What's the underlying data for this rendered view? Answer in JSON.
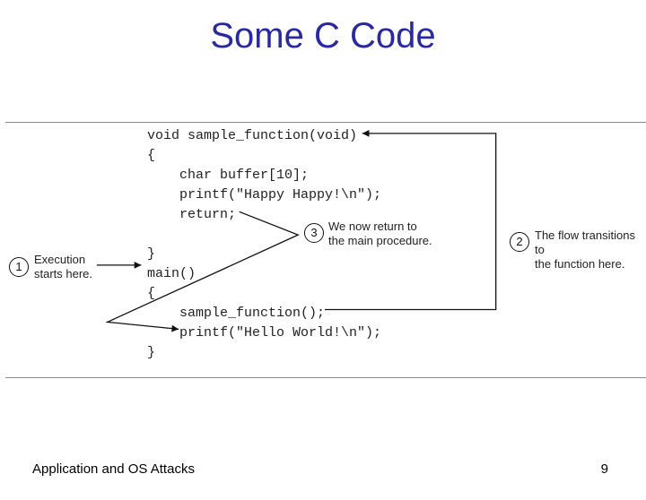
{
  "title": "Some C Code",
  "footer": {
    "left": "Application and OS Attacks",
    "page": "9"
  },
  "code": {
    "l1": "void sample_function(void)",
    "l2": "{",
    "l3": "    char buffer[10];",
    "l4": "    printf(\"Happy Happy!\\n\");",
    "l5": "    return;",
    "l6": "}",
    "l7": "main()",
    "l8": "{",
    "l9": "    sample_function();",
    "l10": "    printf(\"Hello World!\\n\");",
    "l11": "}"
  },
  "markers": {
    "m1": "1",
    "m2": "2",
    "m3": "3"
  },
  "captions": {
    "c1a": "Execution",
    "c1b": "starts here.",
    "c2a": "The flow transitions to",
    "c2b": "the function here.",
    "c3a": "We now return to",
    "c3b": "the main procedure."
  }
}
